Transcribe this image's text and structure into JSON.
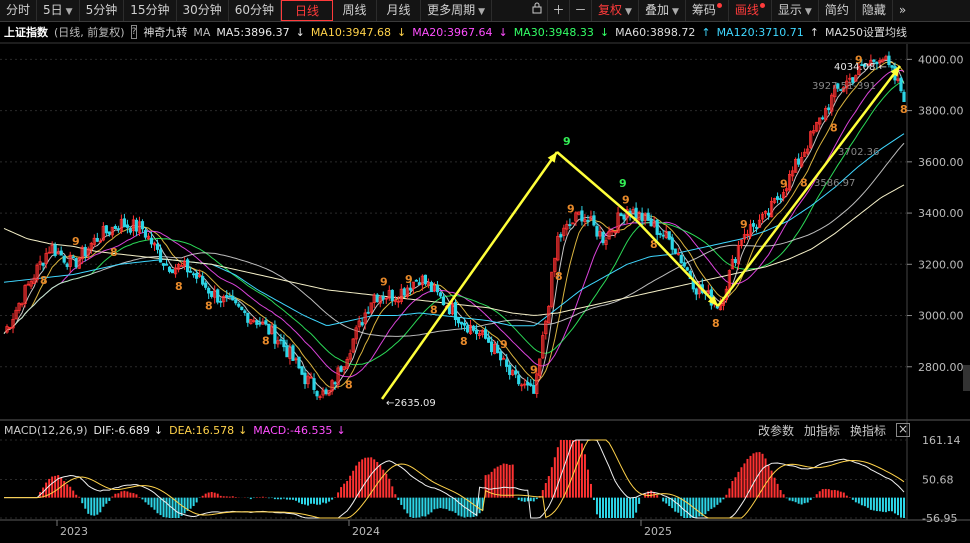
{
  "toolbar": {
    "items": [
      {
        "label": "分时",
        "active": false
      },
      {
        "label": "5日",
        "caret": true
      },
      {
        "label": "5分钟"
      },
      {
        "label": "15分钟"
      },
      {
        "label": "30分钟"
      },
      {
        "label": "60分钟"
      },
      {
        "label": "日线",
        "active": true
      },
      {
        "label": "周线"
      },
      {
        "label": "月线"
      },
      {
        "label": "更多周期",
        "caret": true
      }
    ],
    "icons": [
      "lock-icon",
      "plus-icon",
      "minus-icon"
    ],
    "right_items": [
      {
        "label": "复权",
        "red": true,
        "caret": true
      },
      {
        "label": "叠加",
        "caret": true
      },
      {
        "label": "筹码",
        "dot": true
      },
      {
        "label": "画线",
        "dot": true
      },
      {
        "label": "显示",
        "caret": true
      },
      {
        "label": "简约"
      },
      {
        "label": "隐藏"
      }
    ],
    "more_label": "»"
  },
  "info": {
    "name": "上证指数",
    "mode": "(日线, 前复权)",
    "q": "?",
    "indicator": "神奇九转",
    "ma": "MA",
    "ma5": "MA5:3896.37",
    "ma10": "MA10:3947.68",
    "ma20": "MA20:3967.64",
    "ma30": "MA30:3948.33",
    "ma60": "MA60:3898.72",
    "ma120": "MA120:3710.71",
    "ma250": "MA250设置均线",
    "colors": {
      "ma5": "#e8e8e8",
      "ma10": "#ffd24a",
      "ma20": "#ff4fff",
      "ma30": "#33ff66",
      "ma60": "#dddddd",
      "ma120": "#3fd7ff",
      "ma250": "#dddddd"
    }
  },
  "macd": {
    "label": "MACD(12,26,9)",
    "dif": "DIF:-6.689",
    "dea": "DEA:16.578",
    "macd": "MACD:-46.535",
    "params": "改参数",
    "add": "加指标",
    "switch": "换指标",
    "close": "×",
    "axis": [
      "161.14",
      "50.68",
      "-56.95"
    ]
  },
  "axis": {
    "price_ticks": [
      "4000.00",
      "3800.00",
      "3600.00",
      "3400.00",
      "3200.00",
      "3000.00",
      "2800.00"
    ],
    "year_labels": [
      "2023",
      "2024",
      "2025"
    ]
  },
  "annotations": {
    "high": "4034.08",
    "low": "2635.09",
    "ma120_partial": "3702.36",
    "ma250_partial": "3586.97",
    "ma20_partial": "3927.51-391"
  },
  "chart_data": {
    "type": "candlestick",
    "title": "上证指数",
    "ylim": [
      2600,
      4060
    ],
    "x": [
      "2023",
      "2024",
      "2025"
    ],
    "series": [
      {
        "name": "上证指数",
        "values": [
          2930,
          3110,
          3270,
          3200,
          3300,
          3360,
          3340,
          3200,
          3180,
          3090,
          3030,
          2980,
          2900,
          2760,
          2680,
          2880,
          3080,
          3080,
          3150,
          3060,
          2970,
          2900,
          2760,
          2690,
          3300,
          3400,
          3300,
          3420,
          3360,
          3280,
          3110,
          3040,
          3320,
          3380,
          3530,
          3700,
          3870,
          3950,
          4020,
          3860
        ]
      },
      {
        "name": "MA120",
        "values": [
          3130,
          3140,
          3150,
          3160,
          3180,
          3200,
          3210,
          3220,
          3210,
          3200,
          3160,
          3100,
          3050,
          3000,
          2960,
          2980,
          3000,
          3000,
          3010,
          3000,
          2990,
          2980,
          2960,
          2960,
          3030,
          3100,
          3150,
          3200,
          3230,
          3240,
          3260,
          3280,
          3300,
          3330,
          3370,
          3430,
          3500,
          3580,
          3650,
          3710
        ]
      },
      {
        "name": "MA250",
        "values": [
          3340,
          3300,
          3280,
          3270,
          3250,
          3240,
          3230,
          3220,
          3210,
          3200,
          3180,
          3160,
          3140,
          3120,
          3100,
          3090,
          3080,
          3070,
          3060,
          3050,
          3040,
          3030,
          3010,
          3000,
          3010,
          3030,
          3050,
          3070,
          3090,
          3110,
          3130,
          3150,
          3170,
          3190,
          3220,
          3260,
          3320,
          3390,
          3460,
          3510
        ]
      }
    ],
    "markers": {
      "high": 4034.08,
      "low": 2635.09
    },
    "macd_ylim": [
      -56.95,
      161.14
    ]
  }
}
